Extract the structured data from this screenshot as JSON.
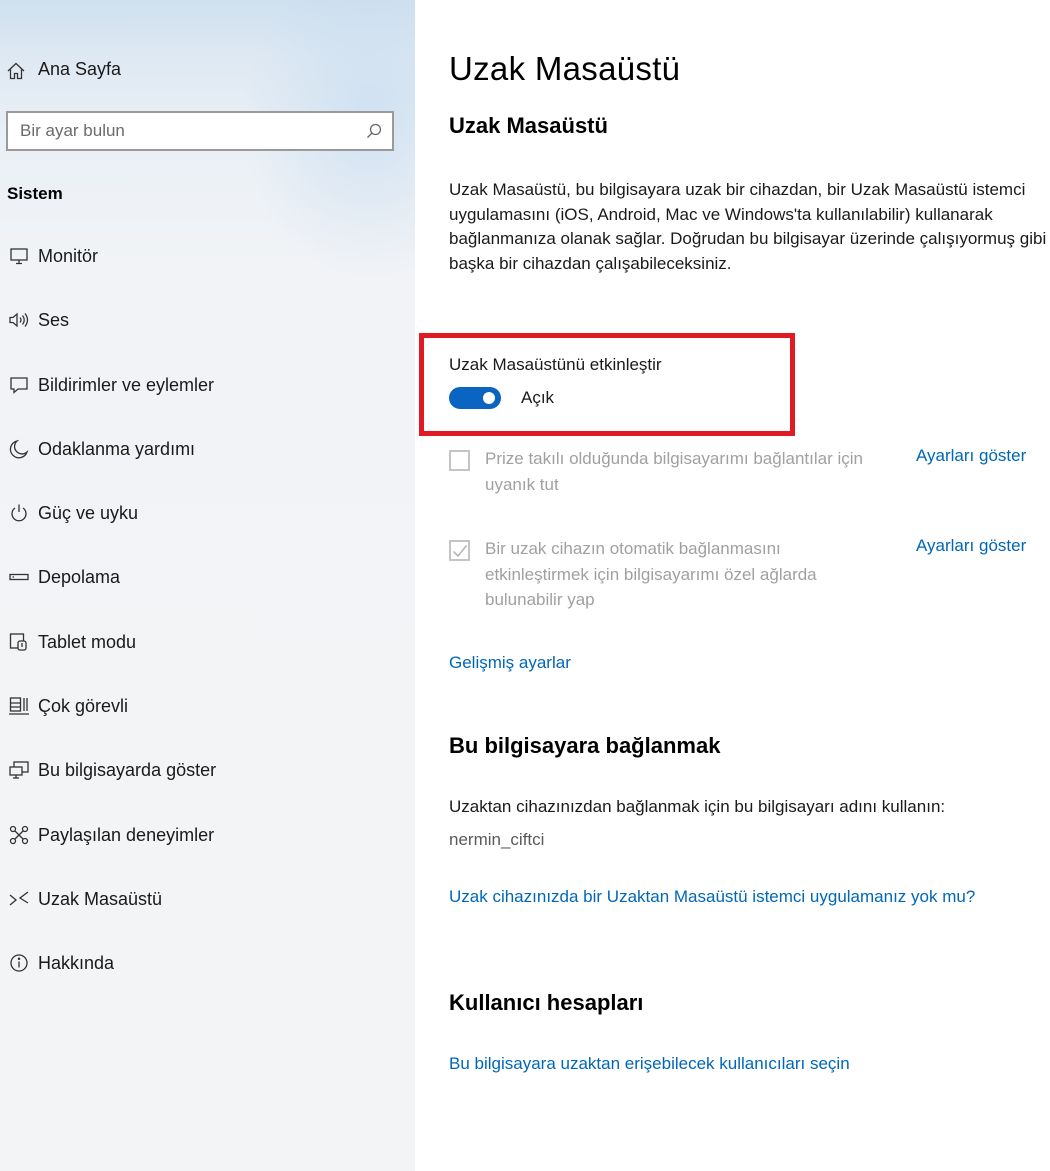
{
  "sidebar": {
    "home_label": "Ana Sayfa",
    "search_placeholder": "Bir ayar bulun",
    "section_heading": "Sistem",
    "items": [
      {
        "label": "Monitör",
        "icon": "monitor-icon"
      },
      {
        "label": "Ses",
        "icon": "speaker-icon"
      },
      {
        "label": "Bildirimler ve eylemler",
        "icon": "notification-icon"
      },
      {
        "label": "Odaklanma yardımı",
        "icon": "moon-icon"
      },
      {
        "label": "Güç ve uyku",
        "icon": "power-icon"
      },
      {
        "label": "Depolama",
        "icon": "storage-icon"
      },
      {
        "label": "Tablet modu",
        "icon": "tablet-mode-icon"
      },
      {
        "label": "Çok görevli",
        "icon": "multitasking-icon"
      },
      {
        "label": "Bu bilgisayarda göster",
        "icon": "project-icon"
      },
      {
        "label": "Paylaşılan deneyimler",
        "icon": "shared-experiences-icon"
      },
      {
        "label": "Uzak Masaüstü",
        "icon": "remote-desktop-icon"
      },
      {
        "label": "Hakkında",
        "icon": "info-icon"
      }
    ]
  },
  "main": {
    "page_title": "Uzak Masaüstü",
    "subtitle": "Uzak Masaüstü",
    "description": "Uzak Masaüstü, bu bilgisayara uzak bir cihazdan, bir Uzak Masaüstü istemci uygulamasını (iOS, Android, Mac ve Windows'ta kullanılabilir) kullanarak bağlanmanıza olanak sağlar. Doğrudan bu bilgisayar üzerinde çalışıyormuş gibi başka bir cihazdan çalışabileceksiniz.",
    "toggle": {
      "label": "Uzak Masaüstünü etkinleştir",
      "state_text": "Açık",
      "on": true,
      "color": "#0a64c2"
    },
    "options": [
      {
        "text": "Prize takılı olduğunda bilgisayarımı bağlantılar için uyanık tut",
        "checked": false,
        "link": "Ayarları göster"
      },
      {
        "text": "Bir uzak cihazın otomatik bağlanmasını etkinleştirmek için bilgisayarımı özel ağlarda bulunabilir yap",
        "checked": true,
        "link": "Ayarları göster"
      }
    ],
    "advanced_link": "Gelişmiş ayarlar",
    "connect_section": {
      "title": "Bu bilgisayara bağlanmak",
      "instruction": "Uzaktan cihazınızdan bağlanmak için bu bilgisayarı adını kullanın:",
      "pc_name": "nermin_ciftci",
      "no_client_link": "Uzak cihazınızda bir Uzaktan Masaüstü istemci uygulamanız yok mu?"
    },
    "accounts_section": {
      "title": "Kullanıcı hesapları",
      "select_users_link": "Bu bilgisayara uzaktan erişebilecek kullanıcıları seçin"
    }
  },
  "colors": {
    "accent": "#0067b8",
    "highlight": "#e01b24",
    "disabled_text": "#a0a0a0"
  }
}
